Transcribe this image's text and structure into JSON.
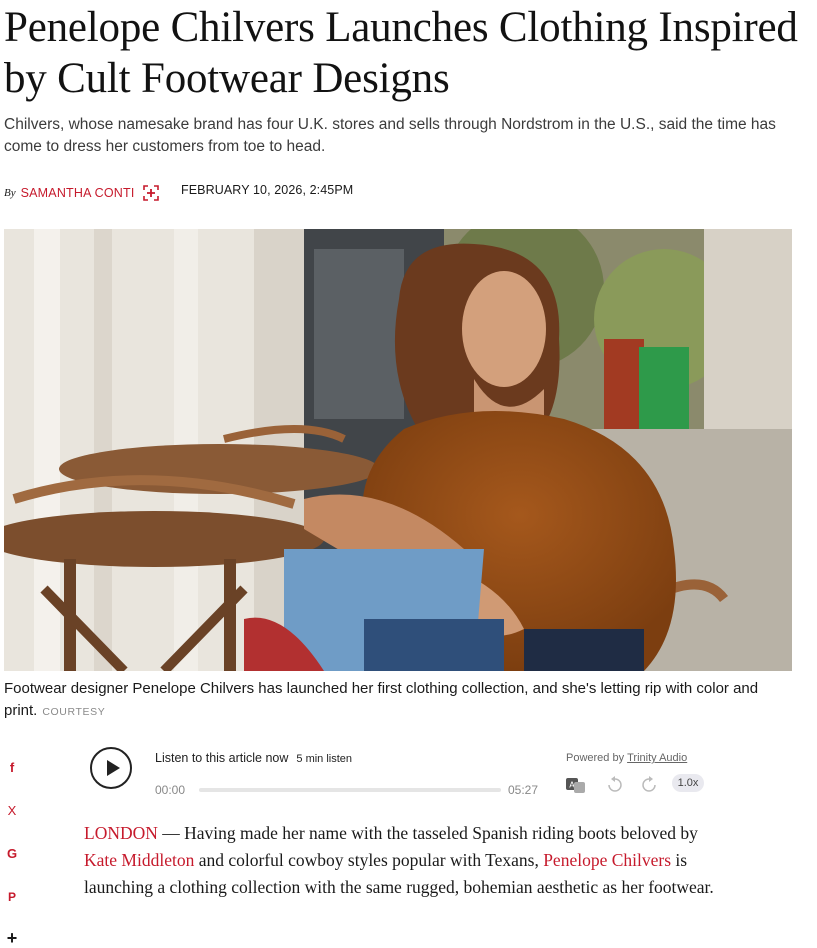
{
  "article": {
    "headline": "Penelope Chilvers Launches Clothing Inspired by Cult Footwear Designs",
    "dek": "Chilvers, whose namesake brand has four U.K. stores and sells through Nordstrom in the U.S., said the time has come to dress her customers from toe to head.",
    "byline_prefix": "By",
    "author": "SAMANTHA CONTI",
    "date": "FEBRUARY 10, 2026, 2:45PM",
    "caption": "Footwear designer Penelope Chilvers has launched her first clothing collection, and she's letting rip with color and print.",
    "credit": "COURTESY",
    "body": {
      "dateline": "LONDON",
      "dash": " — Having made her name with the tasseled Spanish riding boots beloved by ",
      "link1": "Kate Middleton",
      "text2": " and colorful cowboy styles popular with Texans, ",
      "link2": "Penelope Chilvers",
      "text3": " is launching a clothing collection with the same rugged, bohemian aesthetic as her footwear."
    }
  },
  "audio_player": {
    "listen_label": "Listen to this article now",
    "duration_label": "5 min listen",
    "time_current": "00:00",
    "time_total": "05:27",
    "powered_by": "Powered by",
    "provider": "Trinity Audio",
    "speed": "1.0x",
    "progress": 0
  },
  "share": {
    "icons": [
      "facebook-icon",
      "x-icon",
      "google-icon",
      "pinterest-icon",
      "plus-icon"
    ],
    "labels": [
      "f",
      "X",
      "G",
      "P",
      "+"
    ]
  },
  "colors": {
    "accent": "#c61a2c",
    "text": "#1a1a1a",
    "muted": "#888888"
  }
}
